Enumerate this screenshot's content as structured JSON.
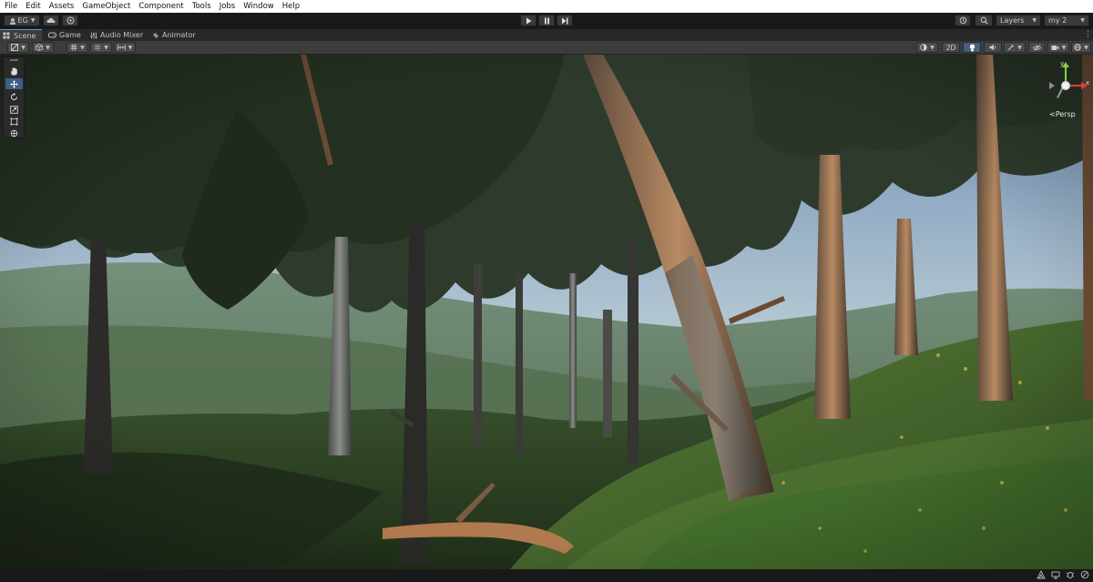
{
  "menubar": {
    "items": [
      "File",
      "Edit",
      "Assets",
      "GameObject",
      "Component",
      "Tools",
      "Jobs",
      "Window",
      "Help"
    ]
  },
  "toolbar": {
    "account_label": "EG",
    "cloud_icon": "cloud-icon",
    "collab_icon": "collab-icon",
    "play_icon": "play-icon",
    "pause_icon": "pause-icon",
    "step_icon": "step-icon",
    "history_icon": "history-icon",
    "search_icon": "search-icon",
    "layers_label": "Layers",
    "layout_label": "my 2"
  },
  "tabs": [
    {
      "label": "Scene",
      "icon": "scene-grid-icon",
      "active": true
    },
    {
      "label": "Game",
      "icon": "gamepad-icon",
      "active": false
    },
    {
      "label": "Audio Mixer",
      "icon": "mixer-icon",
      "active": false
    },
    {
      "label": "Animator",
      "icon": "animator-icon",
      "active": false
    }
  ],
  "scene_toolbar": {
    "toggle_2d_label": "2D"
  },
  "tools": [
    {
      "name": "hand-tool",
      "icon": "hand-icon",
      "active": false
    },
    {
      "name": "move-tool",
      "icon": "move-icon",
      "active": true
    },
    {
      "name": "rotate-tool",
      "icon": "rotate-icon",
      "active": false
    },
    {
      "name": "scale-tool",
      "icon": "scale-icon",
      "active": false
    },
    {
      "name": "rect-tool",
      "icon": "rect-icon",
      "active": false
    },
    {
      "name": "transform-tool",
      "icon": "transform-icon",
      "active": false
    }
  ],
  "gizmo": {
    "axis_x": "x",
    "axis_y": "y",
    "projection_label": "Persp"
  },
  "colors": {
    "accent": "#3e5f87",
    "axis_x": "#e23b3b",
    "axis_y": "#8ad33a",
    "axis_z": "#3a7be2"
  }
}
